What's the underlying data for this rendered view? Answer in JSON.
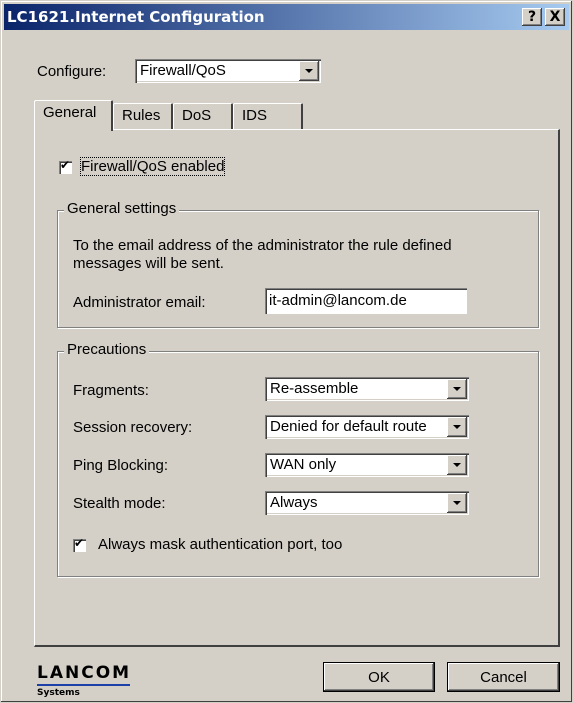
{
  "window": {
    "title": "LC1621.Internet Configuration",
    "help_button": "?",
    "close_button": "X"
  },
  "configure": {
    "label": "Configure:",
    "value": "Firewall/QoS"
  },
  "tabs": [
    {
      "label": "General",
      "active": true
    },
    {
      "label": "Rules",
      "active": false
    },
    {
      "label": "DoS",
      "active": false
    },
    {
      "label": "IDS",
      "active": false
    }
  ],
  "firewall_enabled": {
    "label": "Firewall/QoS enabled",
    "checked": true
  },
  "general_settings": {
    "legend": "General settings",
    "description_line1": "To the email address of the administrator the rule defined",
    "description_line2": "messages will be sent.",
    "admin_email_label": "Administrator email:",
    "admin_email_value": "it-admin@lancom.de"
  },
  "precautions": {
    "legend": "Precautions",
    "fragments_label": "Fragments:",
    "fragments_value": "Re-assemble",
    "session_recovery_label": "Session recovery:",
    "session_recovery_value": "Denied for default route",
    "ping_blocking_label": "Ping Blocking:",
    "ping_blocking_value": "WAN only",
    "stealth_mode_label": "Stealth mode:",
    "stealth_mode_value": "Always",
    "mask_auth_label": "Always mask authentication port, too",
    "mask_auth_checked": true
  },
  "footer": {
    "logo_text": "LANCOM",
    "logo_sub": "Systems",
    "ok_label": "OK",
    "cancel_label": "Cancel"
  }
}
